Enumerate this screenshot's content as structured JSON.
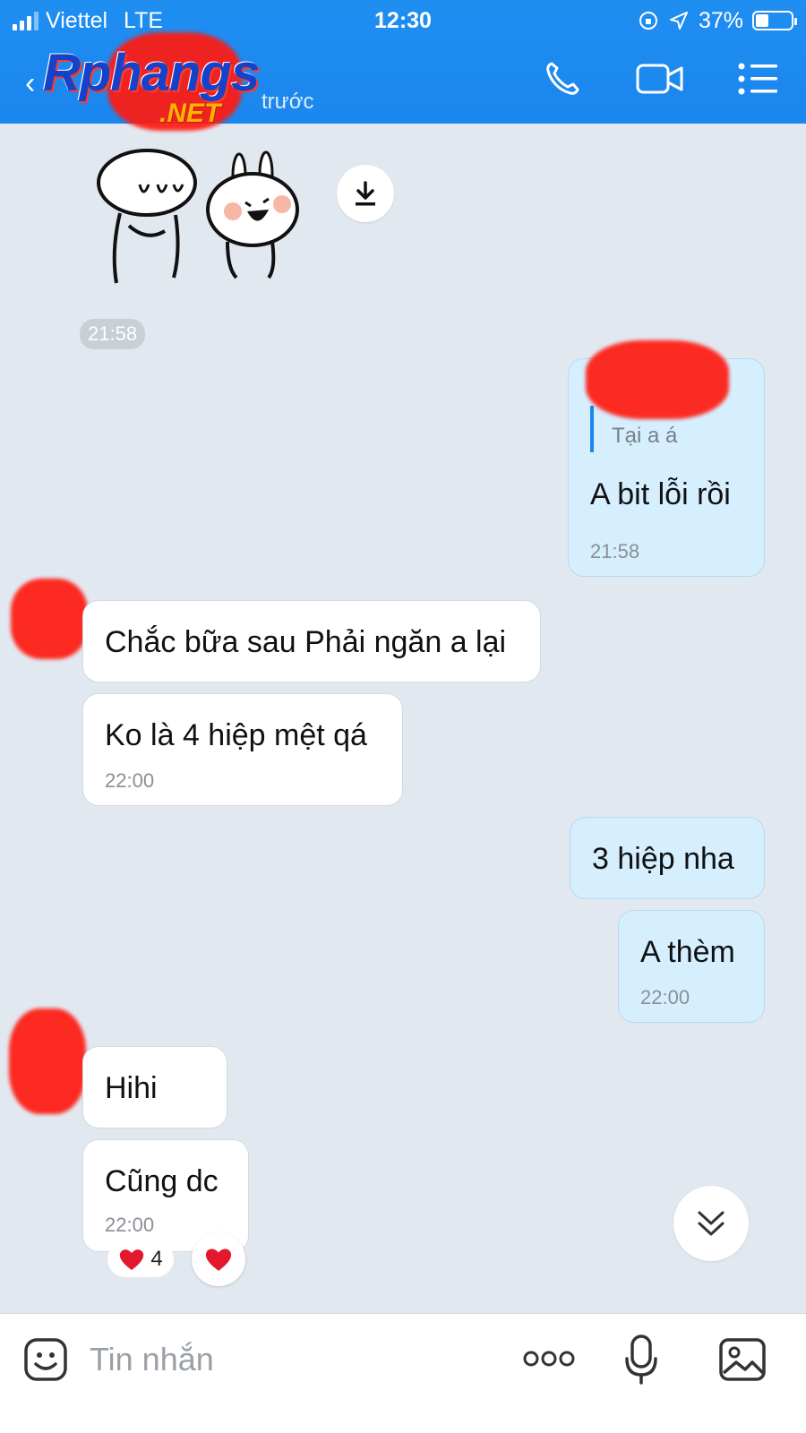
{
  "status_bar": {
    "carrier": "Viettel",
    "network": "LTE",
    "time": "12:30",
    "battery": "37%",
    "battery_level": 0.37
  },
  "header": {
    "logo_main": "Rphangs",
    "logo_suffix": ".NET",
    "subtitle": "trước"
  },
  "messages": {
    "sticker_time": "21:58",
    "reply": {
      "quote": "Tại a á",
      "text": "A bit lỗi rồi",
      "time": "21:58"
    },
    "m1": "Chắc bữa sau Phải ngăn a lại",
    "m2": "Ko là 4 hiệp mệt qá",
    "m2_time": "22:00",
    "m3": "3 hiệp nha",
    "m4": "A thèm",
    "m4_time": "22:00",
    "m5": "Hihi",
    "m6": "Cũng dc",
    "m6_time": "22:00",
    "reaction_count": "4"
  },
  "composer": {
    "placeholder": "Tin nhắn"
  },
  "colors": {
    "header": "#1f8ef1",
    "background": "#e2e8f0",
    "my_bubble": "#d6efff",
    "their_bubble": "#ffffff"
  },
  "icons": [
    "back-icon",
    "phone-icon",
    "video-icon",
    "menu-icon",
    "download-icon",
    "chevron-double-down-icon",
    "emoji-icon",
    "more-icon",
    "mic-icon",
    "image-icon",
    "heart-icon"
  ]
}
